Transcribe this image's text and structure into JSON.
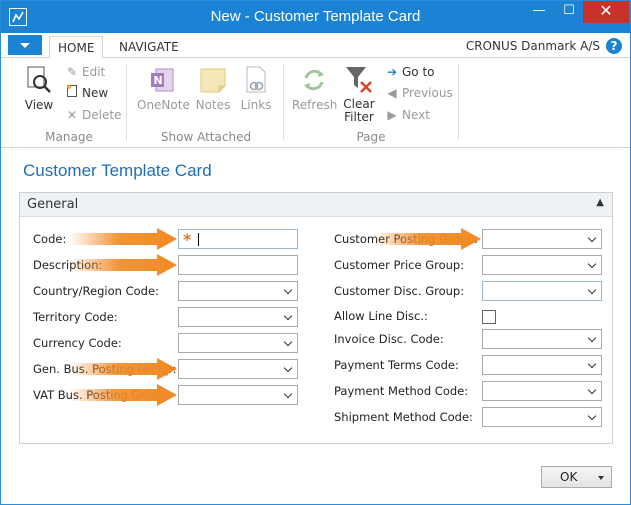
{
  "window": {
    "title": "New - Customer Template Card",
    "controls": {
      "minimize": "—",
      "maximize": "☐",
      "close": "✕"
    }
  },
  "ribbon_tabs": {
    "home": "HOME",
    "navigate": "NAVIGATE",
    "company": "CRONUS Danmark A/S",
    "help": "?"
  },
  "ribbon": {
    "manage": {
      "label": "Manage",
      "view": "View",
      "edit": "Edit",
      "new": "New",
      "delete": "Delete"
    },
    "show_attached": {
      "label": "Show Attached",
      "onenote": "OneNote",
      "notes": "Notes",
      "links": "Links"
    },
    "page": {
      "label": "Page",
      "refresh": "Refresh",
      "clear_filter_line1": "Clear",
      "clear_filter_line2": "Filter",
      "goto": "Go to",
      "previous": "Previous",
      "next": "Next"
    }
  },
  "page_title": "Customer Template Card",
  "general": {
    "title": "General",
    "left_fields": [
      {
        "label": "Code:",
        "value": ""
      },
      {
        "label": "Description:",
        "value": ""
      },
      {
        "label": "Country/Region Code:",
        "value": ""
      },
      {
        "label": "Territory Code:",
        "value": ""
      },
      {
        "label": "Currency Code:",
        "value": ""
      },
      {
        "label": "Gen. Bus. Posting Group:",
        "value": ""
      },
      {
        "label": "VAT Bus. Posting Group:",
        "value": ""
      }
    ],
    "right_fields": [
      {
        "label": "Customer Posting Group:",
        "value": ""
      },
      {
        "label": "Customer Price Group:",
        "value": ""
      },
      {
        "label": "Customer Disc. Group:",
        "value": ""
      },
      {
        "label": "Allow Line Disc.:",
        "value": ""
      },
      {
        "label": "Invoice Disc. Code:",
        "value": ""
      },
      {
        "label": "Payment Terms Code:",
        "value": ""
      },
      {
        "label": "Payment Method Code:",
        "value": ""
      },
      {
        "label": "Shipment Method Code:",
        "value": ""
      }
    ],
    "required_marker": "*"
  },
  "footer": {
    "ok": "OK"
  },
  "colors": {
    "accent": "#1a83d3",
    "title_text": "#1e6fb8",
    "highlight_arrow": "#f08a24"
  }
}
